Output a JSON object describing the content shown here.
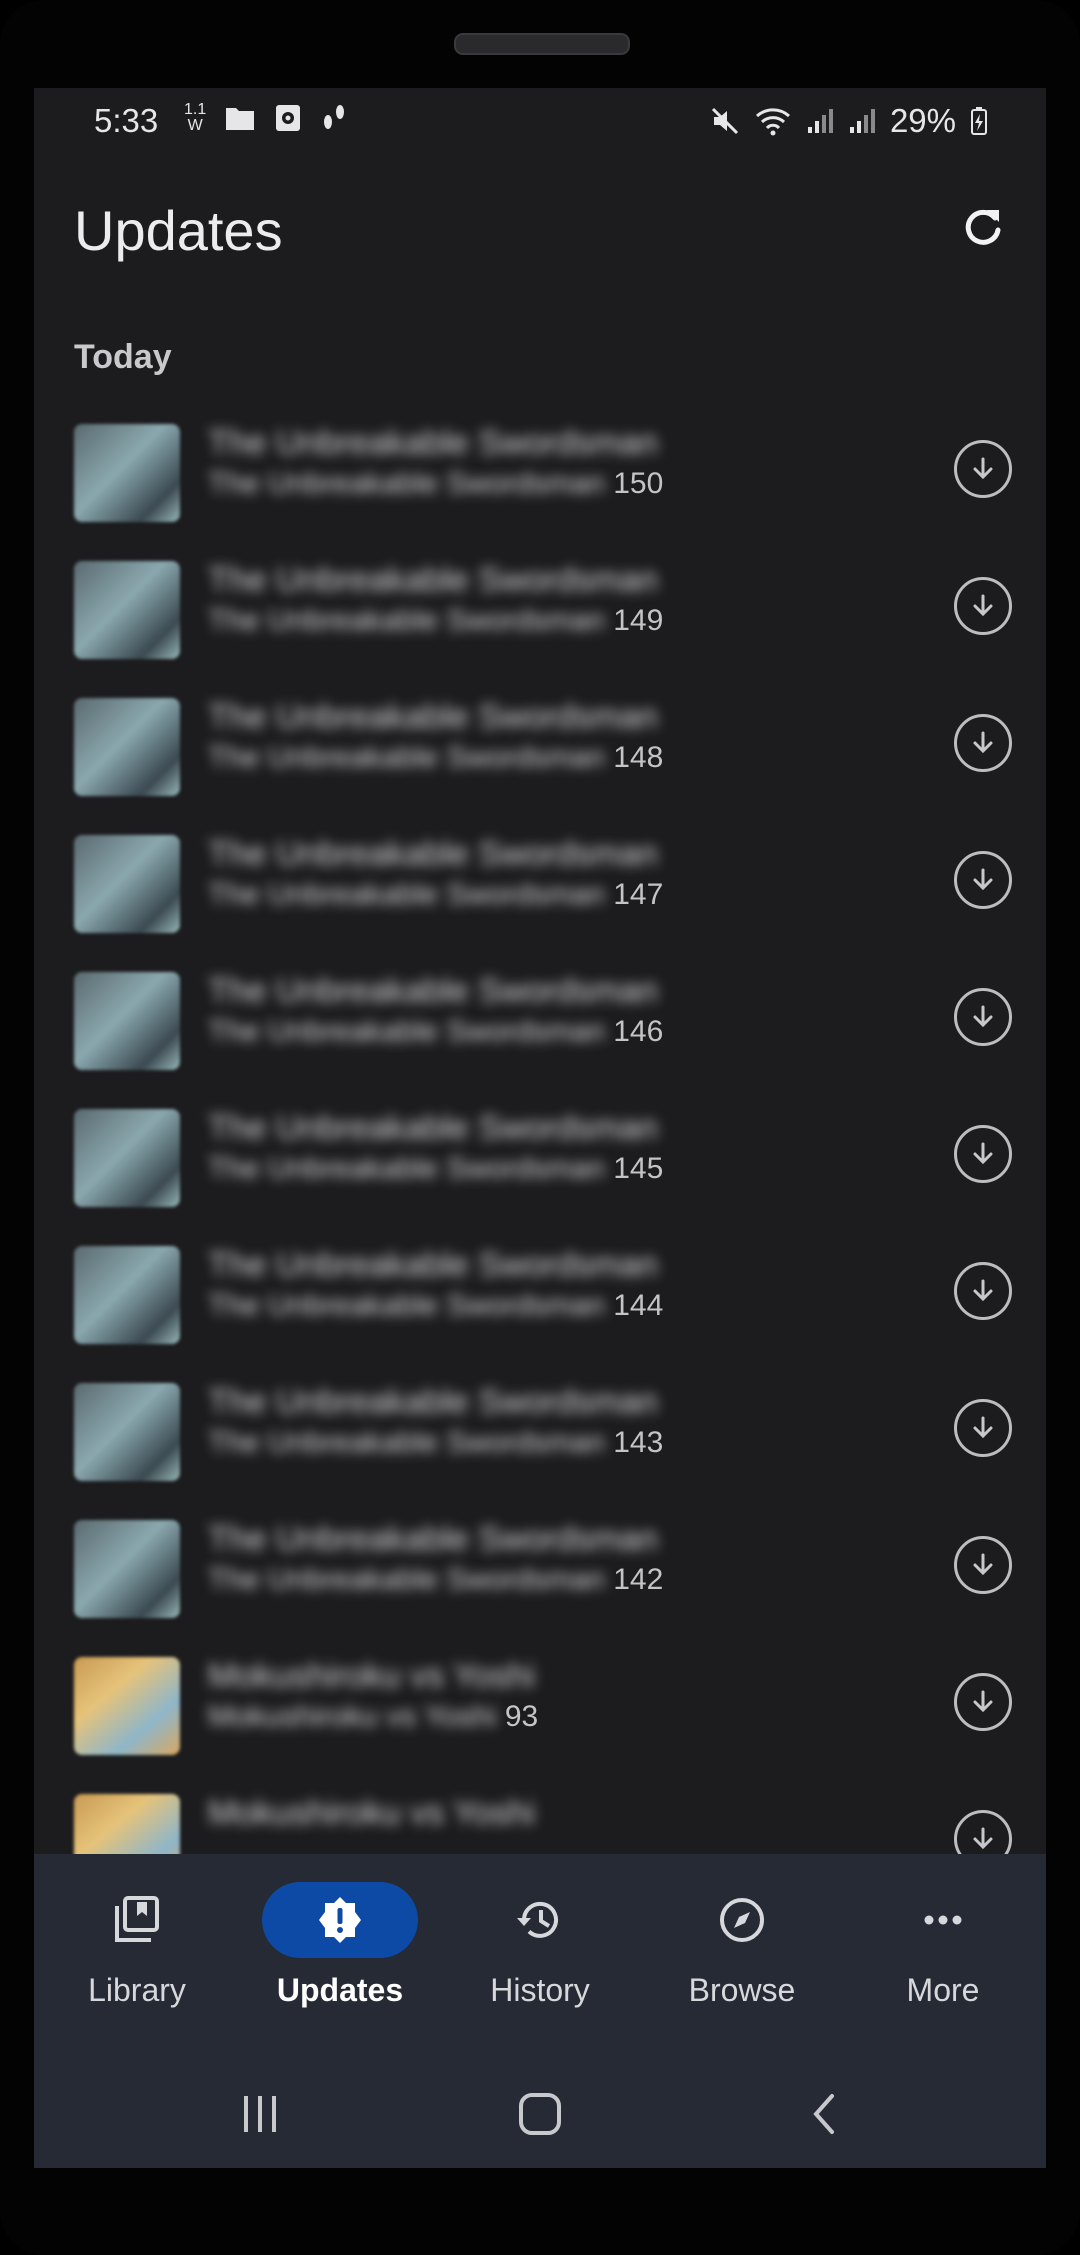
{
  "status_bar": {
    "time": "5:33",
    "volte_top": "1.1",
    "volte_bottom": "W",
    "battery": "29%"
  },
  "app_bar": {
    "title": "Updates"
  },
  "section_header": "Today",
  "updates": [
    {
      "title": "The Unbreakable Swordsman",
      "chapter_prefix": "The Unbreakable Swordsman",
      "chapter_number": "150"
    },
    {
      "title": "The Unbreakable Swordsman",
      "chapter_prefix": "The Unbreakable Swordsman",
      "chapter_number": "149"
    },
    {
      "title": "The Unbreakable Swordsman",
      "chapter_prefix": "The Unbreakable Swordsman",
      "chapter_number": "148"
    },
    {
      "title": "The Unbreakable Swordsman",
      "chapter_prefix": "The Unbreakable Swordsman",
      "chapter_number": "147"
    },
    {
      "title": "The Unbreakable Swordsman",
      "chapter_prefix": "The Unbreakable Swordsman",
      "chapter_number": "146"
    },
    {
      "title": "The Unbreakable Swordsman",
      "chapter_prefix": "The Unbreakable Swordsman",
      "chapter_number": "145"
    },
    {
      "title": "The Unbreakable Swordsman",
      "chapter_prefix": "The Unbreakable Swordsman",
      "chapter_number": "144"
    },
    {
      "title": "The Unbreakable Swordsman",
      "chapter_prefix": "The Unbreakable Swordsman",
      "chapter_number": "143"
    },
    {
      "title": "The Unbreakable Swordsman",
      "chapter_prefix": "The Unbreakable Swordsman",
      "chapter_number": "142"
    },
    {
      "title": "Mokushiroku vs Yoshi",
      "chapter_prefix": "Mokushiroku vs Yoshi",
      "chapter_number": "93"
    },
    {
      "title": "Mokushiroku vs Yoshi",
      "chapter_prefix": "",
      "chapter_number": ""
    }
  ],
  "bottom_nav": [
    {
      "label": "Library",
      "icon": "library-icon",
      "active": false
    },
    {
      "label": "Updates",
      "icon": "updates-icon",
      "active": true
    },
    {
      "label": "History",
      "icon": "history-icon",
      "active": false
    },
    {
      "label": "Browse",
      "icon": "compass-icon",
      "active": false
    },
    {
      "label": "More",
      "icon": "more-dots-icon",
      "active": false
    }
  ],
  "colors": {
    "background": "#1c1c1e",
    "nav_background": "#262a34",
    "active_indicator": "#0c4aa6"
  }
}
